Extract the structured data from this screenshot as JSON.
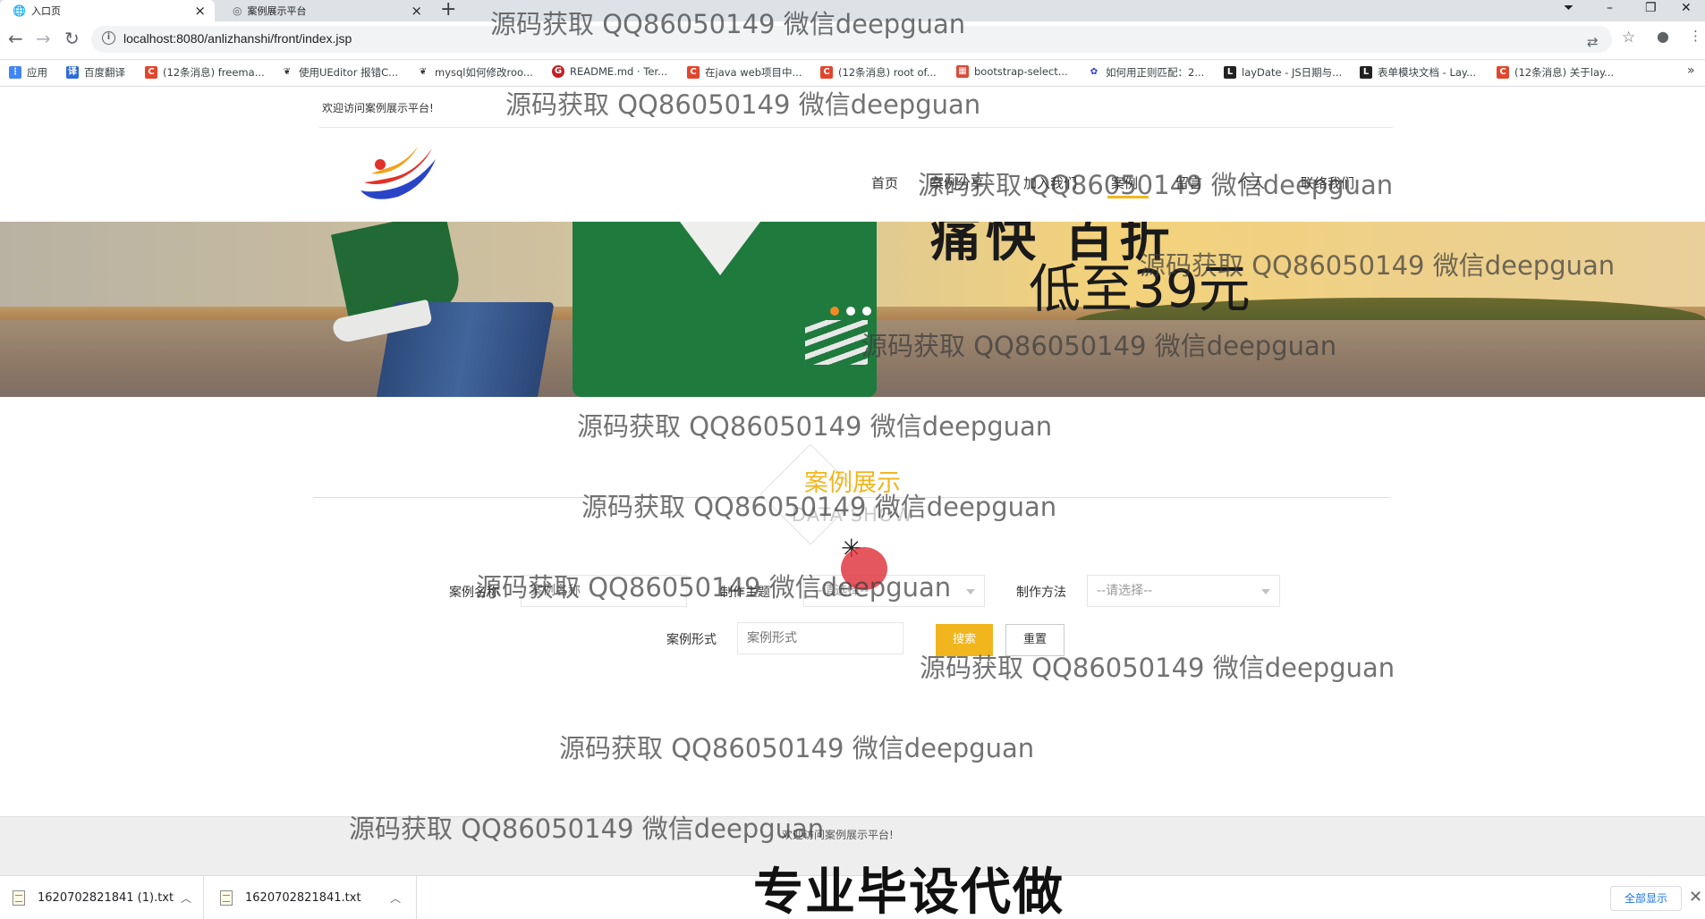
{
  "browser": {
    "tabs": [
      {
        "title": "入口页",
        "active": true
      },
      {
        "title": "案例展示平台",
        "active": false
      }
    ],
    "url": "localhost:8080/anlizhanshi/front/index.jsp",
    "bookmarks": [
      {
        "label": "应用",
        "icon": "apps-grid-icon",
        "color": "#4285f4"
      },
      {
        "label": "百度翻译",
        "icon": "baidu-translate-icon",
        "color": "#2e6bd9"
      },
      {
        "label": "(12条消息) freema...",
        "icon": "csdn-icon",
        "color": "#e2462d"
      },
      {
        "label": "使用UEditor 报错C...",
        "icon": "leaf-icon",
        "color": "#333333"
      },
      {
        "label": "mysql如何修改roo...",
        "icon": "leaf-icon",
        "color": "#333333"
      },
      {
        "label": "README.md · Ter...",
        "icon": "gitee-icon",
        "color": "#c71d23"
      },
      {
        "label": "在java web项目中...",
        "icon": "csdn-icon",
        "color": "#e2462d"
      },
      {
        "label": "(12条消息) root of...",
        "icon": "csdn-icon",
        "color": "#e2462d"
      },
      {
        "label": "bootstrap-select...",
        "icon": "cnblogs-icon",
        "color": "#d84c3a"
      },
      {
        "label": "如何用正则匹配：2...",
        "icon": "baidu-paw-icon",
        "color": "#2932e1"
      },
      {
        "label": "layDate - JS日期与...",
        "icon": "layui-icon",
        "color": "#222222"
      },
      {
        "label": "表单模块文档 - Lay...",
        "icon": "layui-icon",
        "color": "#222222"
      },
      {
        "label": "(12条消息) 关于lay...",
        "icon": "csdn-icon",
        "color": "#e2462d"
      }
    ]
  },
  "site": {
    "welcome": "欢迎访问案例展示平台!",
    "nav": [
      "首页",
      "案例分享",
      "加入我们",
      "案例",
      "留言",
      "个人",
      "联络我们"
    ],
    "banner": {
      "headline": "痛快   百折",
      "subline": "低至39元",
      "active_slide": 1
    },
    "section": {
      "title": "案例展示",
      "subtitle": "DATA SHOW"
    },
    "filters": {
      "case_name_label": "案例名称",
      "case_name_placeholder": "案例名称",
      "theme_label": "制作主题",
      "theme_value": "--请选择--",
      "method_label": "制作方法",
      "method_value": "--请选择--",
      "form_label": "案例形式",
      "form_placeholder": "案例形式",
      "search_label": "搜索",
      "reset_label": "重置"
    },
    "footer": "欢迎访问案例展示平台!"
  },
  "downloads": {
    "items": [
      "1620702821841 (1).txt",
      "1620702821841.txt"
    ],
    "show_all": "全部显示"
  },
  "overlay": {
    "watermark": "源码获取 QQ86050149 微信deepguan",
    "caption": "专业毕设代做"
  },
  "colors": {
    "accent": "#f1b61e",
    "banner_dot_active": "#f08a24"
  }
}
